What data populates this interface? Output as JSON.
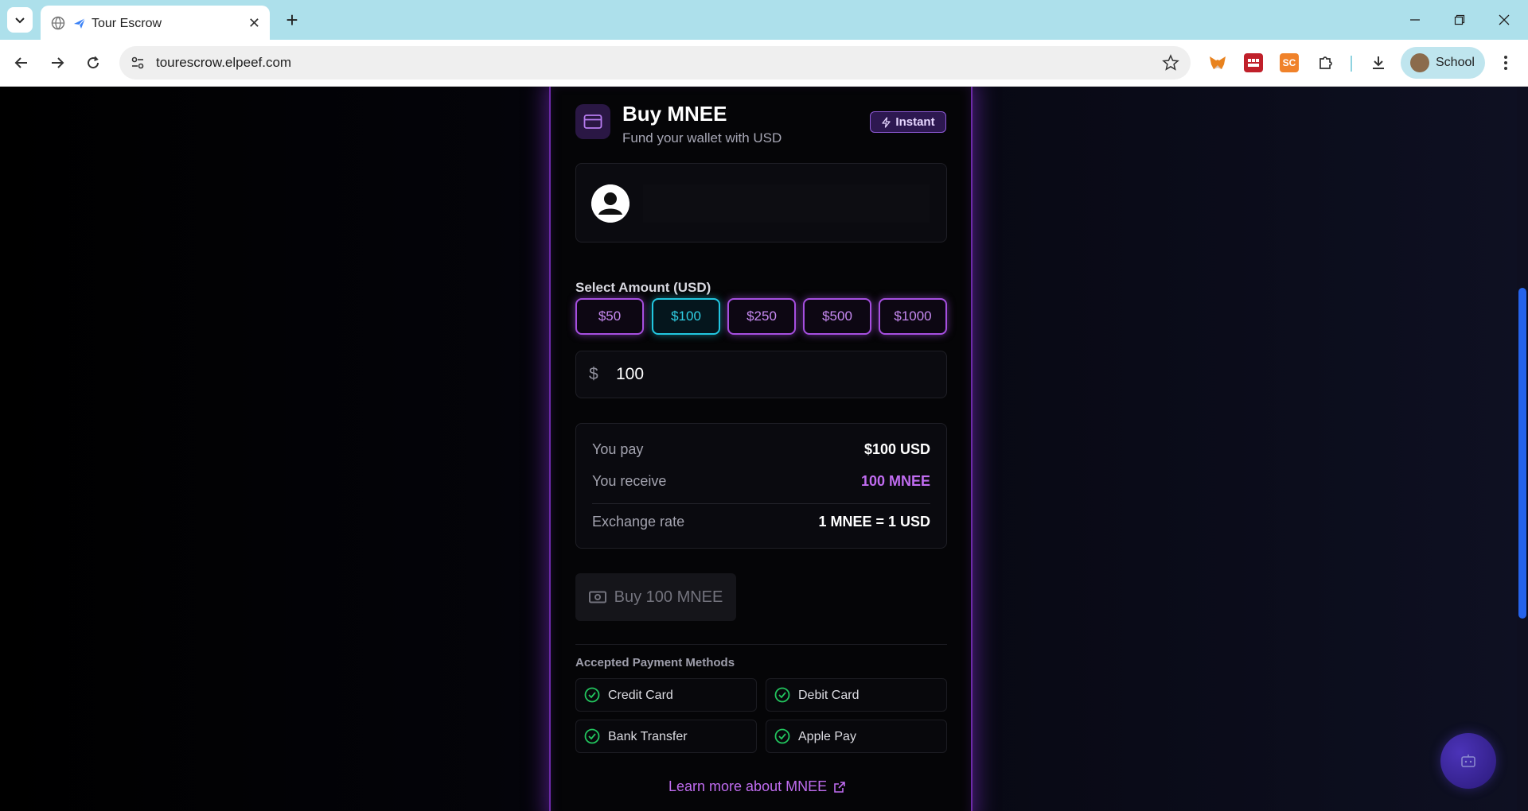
{
  "browser": {
    "tab_title": "Tour Escrow",
    "url": "tourescrow.elpeef.com",
    "profile_name": "School",
    "new_tab_symbol": "+",
    "tab_close_symbol": "✕"
  },
  "card": {
    "title": "Buy MNEE",
    "subtitle": "Fund your wallet with USD",
    "badge": "Instant",
    "select_amount_label": "Select Amount (USD)",
    "amount_options": [
      "$50",
      "$100",
      "$250",
      "$500",
      "$1000"
    ],
    "selected_amount": "$100",
    "currency_symbol": "$",
    "amount_value": "100",
    "summary": {
      "pay_label": "You pay",
      "pay_value": "$100 USD",
      "receive_label": "You receive",
      "receive_value": "100 MNEE",
      "rate_label": "Exchange rate",
      "rate_value": "1 MNEE = 1 USD"
    },
    "buy_button": "Buy 100 MNEE",
    "payment_methods_label": "Accepted Payment Methods",
    "payment_methods": [
      "Credit Card",
      "Debit Card",
      "Bank Transfer",
      "Apple Pay"
    ],
    "learn_more": "Learn more about MNEE"
  },
  "colors": {
    "accent_purple": "#a64fe0",
    "accent_cyan": "#22c7e0",
    "receive_purple": "#c06cf0",
    "check_green": "#22c55e"
  }
}
